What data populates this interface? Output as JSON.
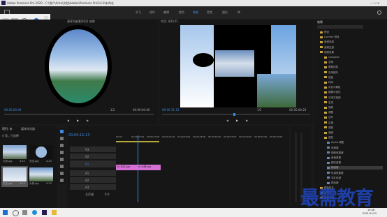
{
  "app": {
    "title": "Adobe Premiere Pro 2020 - C:\\用户\\Ailsa\\文档\\Adobe\\Premiere Pro\\14.0\\未命名"
  },
  "menu": [
    "学习",
    "组件",
    "编辑",
    "颜色",
    "效果",
    "音频",
    "图形",
    "库"
  ],
  "source": {
    "title": "源：(无剪辑)",
    "clip_name": "源序列嵌套序列1 效果",
    "timecode_left": "00:00:00:00",
    "timecode_right": "00:00:00:00",
    "fit": "1/2"
  },
  "program": {
    "title": "节目: 序列 01",
    "timecode_left": "00:00:11:13",
    "timecode_right": "00:00:04:23",
    "fit": "1/2"
  },
  "project": {
    "tab1": "项目: 未",
    "tab2": "媒体浏览器",
    "count": "4 项，已选择",
    "items": [
      {
        "name": "大桥.jpg",
        "duration": "4:23"
      },
      {
        "name": "天空.jpg",
        "duration": "4:23"
      },
      {
        "name": "天空.jpg",
        "duration": "4:23"
      },
      {
        "name": "大桥.jpg",
        "duration": "4:23"
      }
    ]
  },
  "timeline": {
    "timecode": "00:00:11:13",
    "ruler": [
      "00:00",
      "00:00:05:00",
      "00:00:10:00",
      "00:00:15:00",
      "00:00:20:00",
      "00:00:25:00",
      "00:00:30:00",
      "00:00:35:00",
      "00:00:40:00",
      "00:00:45:00",
      "00:00:50:00"
    ],
    "video_tracks": [
      "V3",
      "V2",
      "V1"
    ],
    "audio_tracks": [
      "A1",
      "A2",
      "A3"
    ],
    "master": "主声道",
    "master_value": "0.0",
    "clips": [
      {
        "label": "fx 天空.jpg"
      },
      {
        "label": "fx 大桥.jpg"
      }
    ]
  },
  "effects": {
    "title": "效果",
    "tree": [
      {
        "label": "预设",
        "type": "folder"
      },
      {
        "label": "Lumetri 预设",
        "type": "folder"
      },
      {
        "label": "音频效果",
        "type": "folder"
      },
      {
        "label": "音频过渡",
        "type": "folder"
      },
      {
        "label": "视频效果",
        "type": "folder"
      },
      {
        "label": "Obsolete",
        "type": "folder"
      },
      {
        "label": "变换",
        "type": "folder"
      },
      {
        "label": "图像控制",
        "type": "folder"
      },
      {
        "label": "实用程序",
        "type": "folder"
      },
      {
        "label": "扭曲",
        "type": "folder"
      },
      {
        "label": "时间",
        "type": "folder"
      },
      {
        "label": "杂色与颗粒",
        "type": "folder"
      },
      {
        "label": "模糊与锐化",
        "type": "folder"
      },
      {
        "label": "沉浸式视频",
        "type": "folder"
      },
      {
        "label": "生成",
        "type": "folder"
      },
      {
        "label": "视频",
        "type": "folder"
      },
      {
        "label": "调整",
        "type": "folder"
      },
      {
        "label": "过时",
        "type": "folder"
      },
      {
        "label": "过渡",
        "type": "folder"
      },
      {
        "label": "透视",
        "type": "folder"
      },
      {
        "label": "通道",
        "type": "folder"
      },
      {
        "label": "键控",
        "type": "folder"
      },
      {
        "label": "Alpha 调整",
        "type": "fx"
      },
      {
        "label": "亮度键",
        "type": "fx"
      },
      {
        "label": "图像遮罩键",
        "type": "fx"
      },
      {
        "label": "差值遮罩",
        "type": "fx"
      },
      {
        "label": "移除遮罩",
        "type": "fx"
      },
      {
        "label": "超级键",
        "type": "fx"
      },
      {
        "label": "轨道遮罩键",
        "type": "fx"
      },
      {
        "label": "非红色键",
        "type": "fx"
      },
      {
        "label": "颜色键",
        "type": "fx"
      },
      {
        "label": "颜色校正",
        "type": "folder"
      },
      {
        "label": "风格化",
        "type": "folder"
      },
      {
        "label": "视频过渡",
        "type": "folder"
      }
    ],
    "selected_index": 27
  },
  "watermark": "最需教育",
  "taskbar": {
    "time": "10:46",
    "date": "2021/11/15"
  },
  "colors": {
    "clip": "#d66fd6",
    "accent": "#3b8be0",
    "folder": "#c9a23d",
    "watermark": "#1e3fa8"
  }
}
